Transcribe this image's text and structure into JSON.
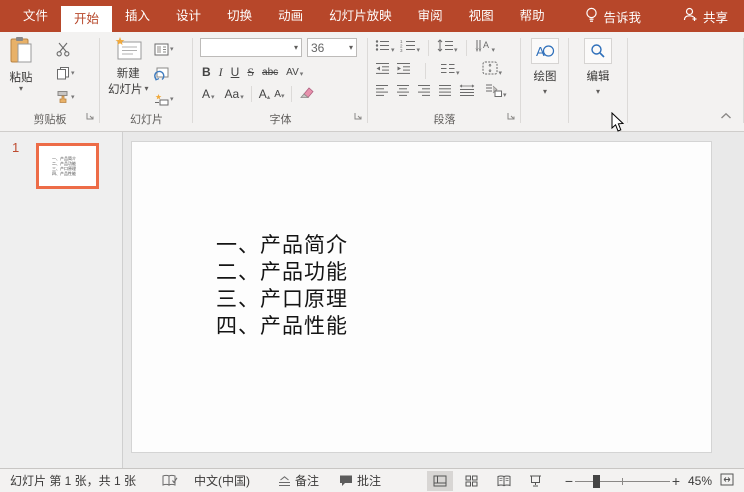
{
  "titlebar": {
    "tabs": [
      {
        "label": "文件"
      },
      {
        "label": "开始"
      },
      {
        "label": "插入"
      },
      {
        "label": "设计"
      },
      {
        "label": "切换"
      },
      {
        "label": "动画"
      },
      {
        "label": "幻灯片放映"
      },
      {
        "label": "审阅"
      },
      {
        "label": "视图"
      },
      {
        "label": "帮助"
      }
    ],
    "tell_me": "告诉我",
    "share": "共享"
  },
  "ribbon": {
    "paste_label": "粘贴",
    "clipboard_group_label": "剪贴板",
    "new_slide_line1": "新建",
    "new_slide_line2": "幻灯片",
    "slides_group_label": "幻灯片",
    "font_name_value": "",
    "font_size_value": "36",
    "font_group_label": "字体",
    "bold_label": "B",
    "italic_label": "I",
    "underline_label": "U",
    "strikethrough_label": "S",
    "clear_format_label": "abc",
    "char_spacing_label": "AV",
    "font_color_label": "A",
    "change_case_label": "Aa",
    "grow_font_label": "A",
    "shrink_font_label": "A",
    "paragraph_group_label": "段落",
    "drawing_label": "绘图",
    "editing_label": "编辑"
  },
  "slide_panel": {
    "slide_number": "1"
  },
  "slide": {
    "lines": [
      "一、产品简介",
      "二、产品功能",
      "三、产口原理",
      "四、产品性能"
    ]
  },
  "statusbar": {
    "slide_info": "幻灯片 第 1 张，共 1 张",
    "language": "中文(中国)",
    "notes_label": "备注",
    "comments_label": "批注",
    "zoom_out": "−",
    "zoom_in": "+",
    "zoom_level": "45%"
  },
  "icons": {
    "dropdown_glyph": "▾",
    "collapse_ribbon": "chevron-up",
    "brand_color": "#B7472A",
    "selection_color": "#ED6C47"
  }
}
